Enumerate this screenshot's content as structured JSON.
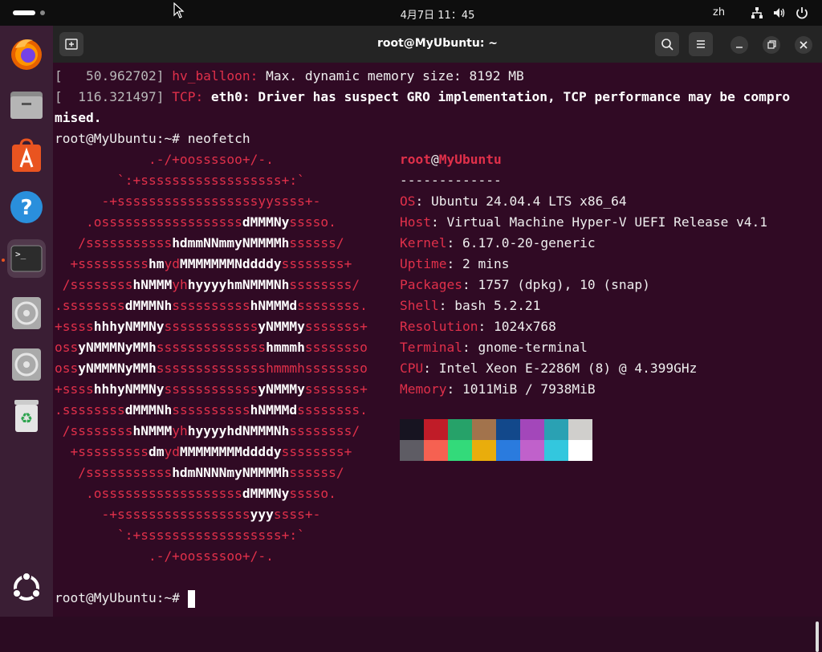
{
  "topbar": {
    "clock": "4月7日 11：45",
    "lang": "zh"
  },
  "dock": {
    "items": [
      {
        "name": "firefox-icon",
        "label": "Firefox"
      },
      {
        "name": "files-icon",
        "label": "Files"
      },
      {
        "name": "app-center-icon",
        "label": "App Center"
      },
      {
        "name": "help-icon",
        "label": "Help"
      },
      {
        "name": "terminal-icon",
        "label": "Terminal"
      },
      {
        "name": "disc-icon",
        "label": "Disc"
      },
      {
        "name": "disc-icon",
        "label": "Disc"
      },
      {
        "name": "trash-icon",
        "label": "Trash"
      },
      {
        "name": "show-apps-icon",
        "label": "Show Apps"
      }
    ]
  },
  "window": {
    "title": "root@MyUbuntu: ~"
  },
  "terminal": {
    "dmesg": [
      {
        "ts": "[   50.962702]",
        "src": "hv_balloon:",
        "msg": " Max. dynamic memory size: 8192 MB"
      },
      {
        "ts": "[  116.321497]",
        "src": "TCP:",
        "msg": " eth0: Driver has suspect GRO implementation, TCP performance may be compro",
        "cont": "mised."
      }
    ],
    "prompt": "root@MyUbuntu:~# ",
    "command": "neofetch",
    "neofetch": {
      "user": "root",
      "at": "@",
      "host": "MyUbuntu",
      "separator": "-------------",
      "fields": [
        {
          "key": "OS",
          "value": ": Ubuntu 24.04.4 LTS x86_64"
        },
        {
          "key": "Host",
          "value": ": Virtual Machine Hyper-V UEFI Release v4.1"
        },
        {
          "key": "Kernel",
          "value": ": 6.17.0-20-generic"
        },
        {
          "key": "Uptime",
          "value": ": 2 mins"
        },
        {
          "key": "Packages",
          "value": ": 1757 (dpkg), 10 (snap)"
        },
        {
          "key": "Shell",
          "value": ": bash 5.2.21"
        },
        {
          "key": "Resolution",
          "value": ": 1024x768"
        },
        {
          "key": "Terminal",
          "value": ": gnome-terminal"
        },
        {
          "key": "CPU",
          "value": ": Intel Xeon E-2286M (8) @ 4.399GHz"
        },
        {
          "key": "Memory",
          "value": ": 1011MiB / 7938MiB"
        }
      ],
      "palette_top": [
        "#171421",
        "#c01c28",
        "#26a269",
        "#a2734c",
        "#12488b",
        "#a347ba",
        "#2aa1b3",
        "#d0cfcc"
      ],
      "palette_bottom": [
        "#5e5c64",
        "#f66151",
        "#33da7a",
        "#e9ad0c",
        "#2a7bde",
        "#c061cb",
        "#33c7de",
        "#ffffff"
      ]
    },
    "logo": [
      [
        [
          "            .-/+oossssoo+/-.",
          "r"
        ]
      ],
      [
        [
          "        `:+ssssssssssssssssss+:`",
          "r"
        ]
      ],
      [
        [
          "      -+ssssssssssssssssssyyssss+-",
          "r"
        ]
      ],
      [
        [
          "    .ossssssssssssssssss",
          "r"
        ],
        [
          "dMMMNy",
          "w"
        ],
        [
          "sssso.",
          "r"
        ]
      ],
      [
        [
          "   /sssssssssss",
          "r"
        ],
        [
          "hdmmNNmmyNMMMMh",
          "w"
        ],
        [
          "ssssss/",
          "r"
        ]
      ],
      [
        [
          "  +sssssssss",
          "r"
        ],
        [
          "hm",
          "w"
        ],
        [
          "yd",
          "r"
        ],
        [
          "MMMMMMMNddddy",
          "w"
        ],
        [
          "ssssssss+",
          "r"
        ]
      ],
      [
        [
          " /ssssssss",
          "r"
        ],
        [
          "hNMMM",
          "w"
        ],
        [
          "yh",
          "r"
        ],
        [
          "hyyyyhmNMMMNh",
          "w"
        ],
        [
          "ssssssss/",
          "r"
        ]
      ],
      [
        [
          ".ssssssss",
          "r"
        ],
        [
          "dMMMNh",
          "w"
        ],
        [
          "ssssssssss",
          "r"
        ],
        [
          "hNMMMd",
          "w"
        ],
        [
          "ssssssss.",
          "r"
        ]
      ],
      [
        [
          "+ssss",
          "r"
        ],
        [
          "hhhyNMMNy",
          "w"
        ],
        [
          "ssssssssssss",
          "r"
        ],
        [
          "yNMMMy",
          "w"
        ],
        [
          "sssssss+",
          "r"
        ]
      ],
      [
        [
          "oss",
          "r"
        ],
        [
          "yNMMMNyMMh",
          "w"
        ],
        [
          "ssssssssssssss",
          "r"
        ],
        [
          "hmmmh",
          "w"
        ],
        [
          "ssssssso",
          "r"
        ]
      ],
      [
        [
          "oss",
          "r"
        ],
        [
          "yNMMMNyMMh",
          "w"
        ],
        [
          "sssssssssssssshmmmhssssssso",
          "r"
        ]
      ],
      [
        [
          "+ssss",
          "r"
        ],
        [
          "hhhyNMMNy",
          "w"
        ],
        [
          "ssssssssssss",
          "r"
        ],
        [
          "yNMMMy",
          "w"
        ],
        [
          "sssssss+",
          "r"
        ]
      ],
      [
        [
          ".ssssssss",
          "r"
        ],
        [
          "dMMMNh",
          "w"
        ],
        [
          "ssssssssss",
          "r"
        ],
        [
          "hNMMMd",
          "w"
        ],
        [
          "ssssssss.",
          "r"
        ]
      ],
      [
        [
          " /ssssssss",
          "r"
        ],
        [
          "hNMMM",
          "w"
        ],
        [
          "yh",
          "r"
        ],
        [
          "hyyyyhdNMMMNh",
          "w"
        ],
        [
          "ssssssss/",
          "r"
        ]
      ],
      [
        [
          "  +sssssssss",
          "r"
        ],
        [
          "dm",
          "w"
        ],
        [
          "yd",
          "r"
        ],
        [
          "MMMMMMMMddddy",
          "w"
        ],
        [
          "ssssssss+",
          "r"
        ]
      ],
      [
        [
          "   /sssssssssss",
          "r"
        ],
        [
          "hdmNNNNmyNMMMMh",
          "w"
        ],
        [
          "ssssss/",
          "r"
        ]
      ],
      [
        [
          "    .ossssssssssssssssss",
          "r"
        ],
        [
          "dMMMNy",
          "w"
        ],
        [
          "sssso.",
          "r"
        ]
      ],
      [
        [
          "      -+sssssssssssssssss",
          "r"
        ],
        [
          "yyy",
          "w"
        ],
        [
          "ssss+-",
          "r"
        ]
      ],
      [
        [
          "        `:+ssssssssssssssssss+:`",
          "r"
        ]
      ],
      [
        [
          "            .-/+oossssoo+/-.",
          "r"
        ]
      ]
    ]
  }
}
